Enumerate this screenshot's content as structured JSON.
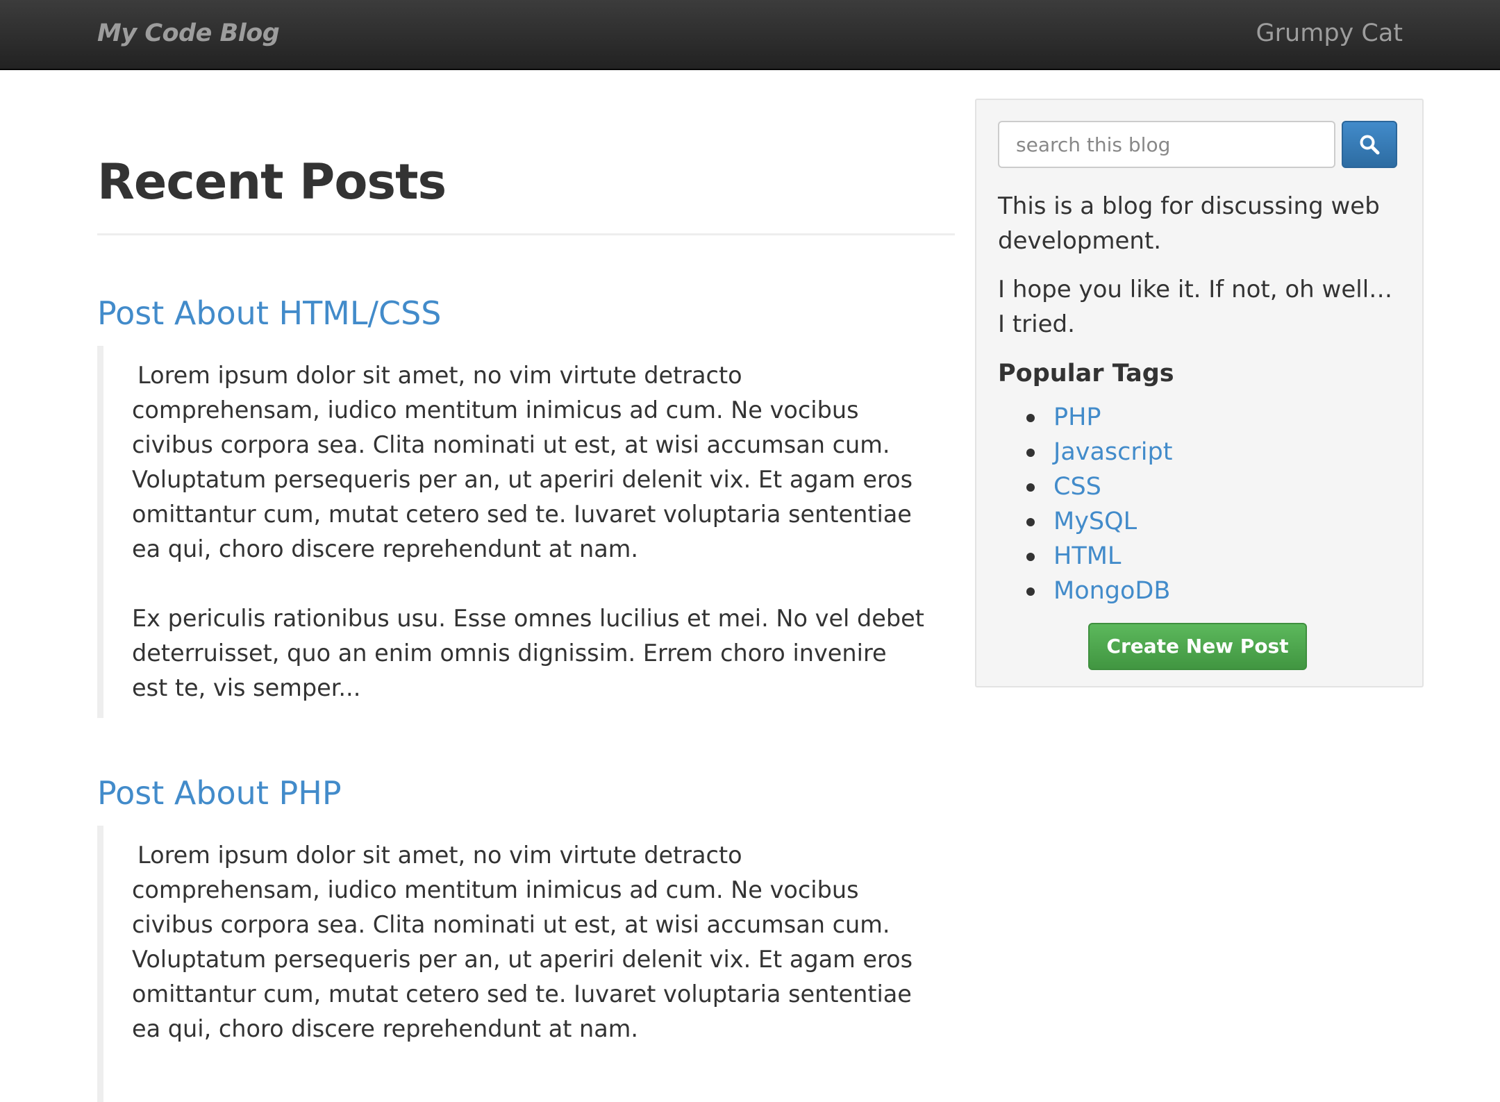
{
  "navbar": {
    "brand": "My Code Blog",
    "user": "Grumpy Cat"
  },
  "main": {
    "title": "Recent Posts",
    "posts": [
      {
        "title": "Post About HTML/CSS",
        "paragraphs": [
          "Lorem ipsum dolor sit amet, no vim virtute detracto comprehensam, iudico mentitum inimicus ad cum. Ne vocibus civibus corpora sea. Clita nominati ut est, at wisi accumsan cum. Voluptatum persequeris per an, ut aperiri delenit vix. Et agam eros omittantur cum, mutat cetero sed te. Iuvaret voluptaria sententiae ea qui, choro discere reprehendunt at nam.",
          "Ex periculis rationibus usu. Esse omnes lucilius et mei. No vel debet deterruisset, quo an enim omnis dignissim. Errem choro invenire est te, vis semper..."
        ]
      },
      {
        "title": "Post About PHP",
        "paragraphs": [
          "Lorem ipsum dolor sit amet, no vim virtute detracto comprehensam, iudico mentitum inimicus ad cum. Ne vocibus civibus corpora sea. Clita nominati ut est, at wisi accumsan cum. Voluptatum persequeris per an, ut aperiri delenit vix. Et agam eros omittantur cum, mutat cetero sed te. Iuvaret voluptaria sententiae ea qui, choro discere reprehendunt at nam."
        ]
      }
    ]
  },
  "sidebar": {
    "search": {
      "placeholder": "search this blog",
      "button_icon": "search-icon"
    },
    "description": [
      "This is a blog for discussing web development.",
      "I hope you like it. If not, oh well… I tried."
    ],
    "tags_heading": "Popular Tags",
    "tags": [
      "PHP",
      "Javascript",
      "CSS",
      "MySQL",
      "HTML",
      "MongoDB"
    ],
    "create_button": "Create New Post"
  },
  "colors": {
    "navbar_top": "#3c3c3c",
    "navbar_bottom": "#222222",
    "link": "#428bca",
    "primary_button": "#428bca",
    "success_button": "#5cb85c",
    "text": "#333333",
    "well_background": "#f5f5f5"
  }
}
